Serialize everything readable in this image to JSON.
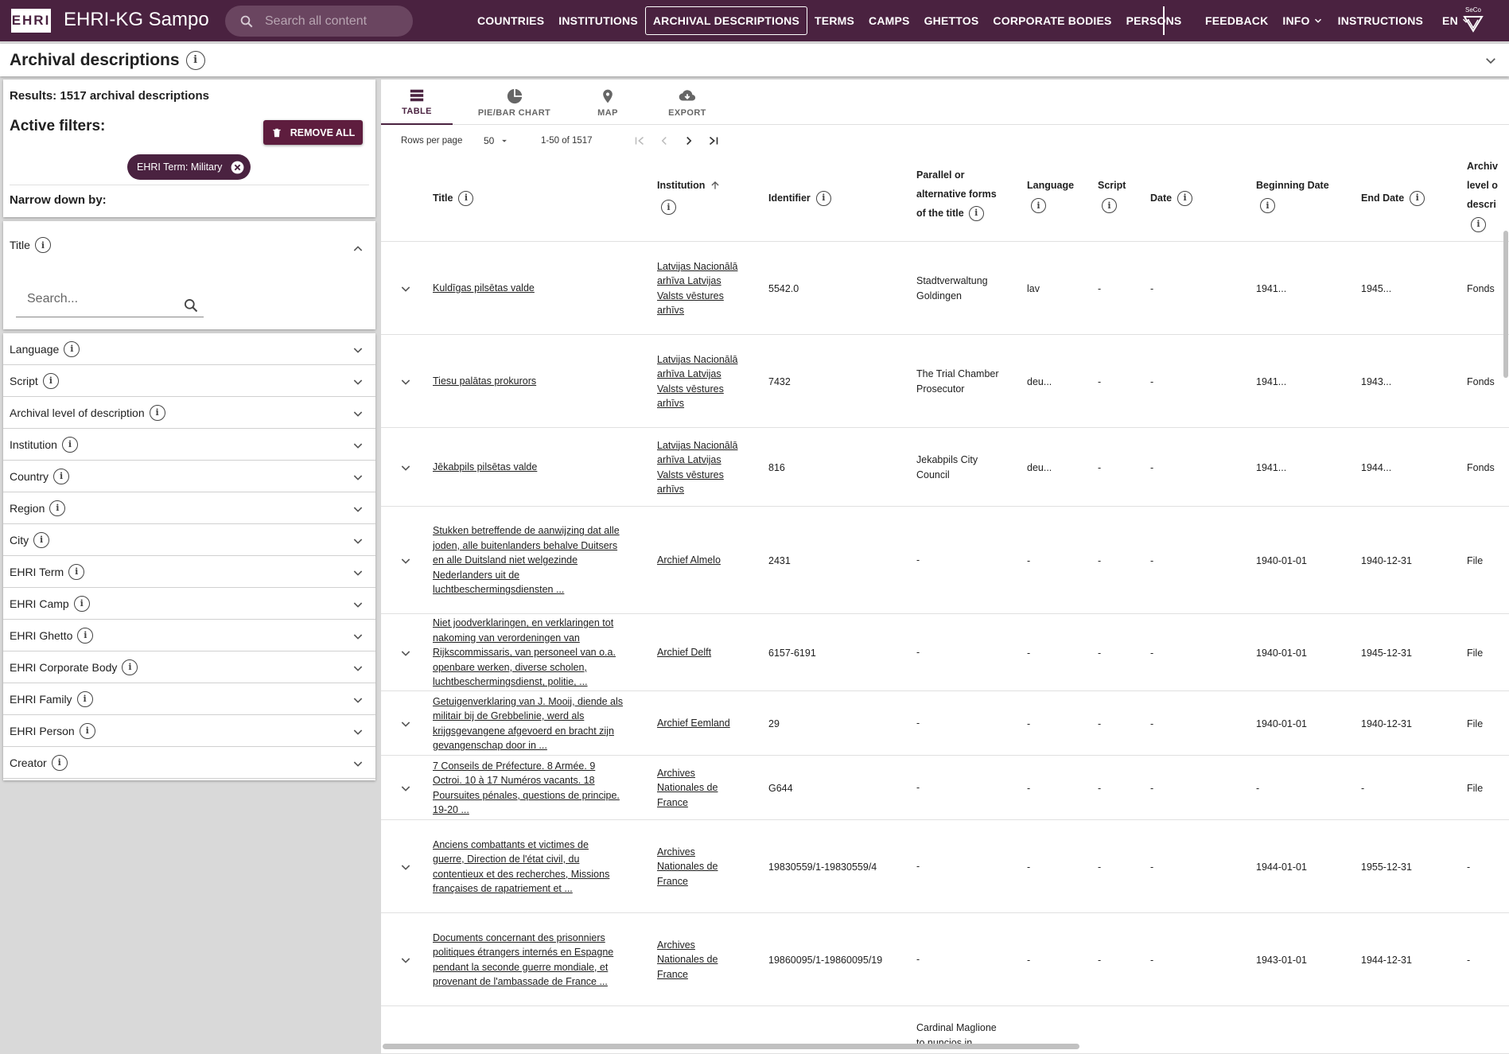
{
  "app": {
    "logo": "EHRI",
    "title": "EHRI-KG Sampo",
    "search_placeholder": "Search all content",
    "seco": "SeCo"
  },
  "nav": [
    "COUNTRIES",
    "INSTITUTIONS",
    "ARCHIVAL DESCRIPTIONS",
    "TERMS",
    "CAMPS",
    "GHETTOS",
    "CORPORATE BODIES",
    "PERSONS"
  ],
  "nav_right": [
    "FEEDBACK",
    "INFO",
    "INSTRUCTIONS",
    "EN"
  ],
  "page": {
    "title": "Archival descriptions"
  },
  "filters": {
    "results": "Results: 1517 archival descriptions",
    "active_label": "Active filters:",
    "remove_all": "REMOVE ALL",
    "chip": "EHRI Term: Military",
    "narrow": "Narrow down by:",
    "title_facet": "Title",
    "search_placeholder": "Search..."
  },
  "facets": [
    "Language",
    "Script",
    "Archival level of description",
    "Institution",
    "Country",
    "Region",
    "City",
    "EHRI Term",
    "EHRI Camp",
    "EHRI Ghetto",
    "EHRI Corporate Body",
    "EHRI Family",
    "EHRI Person",
    "Creator"
  ],
  "tabs": [
    "TABLE",
    "PIE/BAR CHART",
    "MAP",
    "EXPORT"
  ],
  "pagination": {
    "rows_per_page": "Rows per page",
    "rows": "50",
    "range": "1-50 of 1517"
  },
  "columns": {
    "title": "Title",
    "institution": "Institution",
    "identifier": "Identifier",
    "parallel": [
      "Parallel or",
      "alternative forms",
      "of the title"
    ],
    "language": "Language",
    "script": "Script",
    "date": "Date",
    "begin": "Beginning Date",
    "end": "End Date",
    "level": [
      "Archiv",
      "level o",
      "descri"
    ]
  },
  "rows": [
    {
      "title": [
        "Kuldīgas pilsētas valde"
      ],
      "inst": [
        "Latvijas Nacionālā",
        "arhīva Latvijas",
        "Valsts vēstures",
        "arhīvs"
      ],
      "id": "5542.0",
      "par": [
        "Stadtverwaltung",
        "Goldingen"
      ],
      "lang": "lav",
      "script": "-",
      "date": "-",
      "begin": "1941...",
      "end": "1945...",
      "level": "Fonds"
    },
    {
      "title": [
        "Tiesu palātas prokurors"
      ],
      "inst": [
        "Latvijas Nacionālā",
        "arhīva Latvijas",
        "Valsts vēstures",
        "arhīvs"
      ],
      "id": "7432",
      "par": [
        "The Trial Chamber",
        "Prosecutor"
      ],
      "lang": "deu...",
      "script": "-",
      "date": "-",
      "begin": "1941...",
      "end": "1943...",
      "level": "Fonds"
    },
    {
      "title": [
        "Jēkabpils pilsētas valde"
      ],
      "inst": [
        "Latvijas Nacionālā",
        "arhīva Latvijas",
        "Valsts vēstures",
        "arhīvs"
      ],
      "id": "816",
      "par": [
        "Jekabpils City",
        "Council"
      ],
      "lang": "deu...",
      "script": "-",
      "date": "-",
      "begin": "1941...",
      "end": "1944...",
      "level": "Fonds"
    },
    {
      "title": [
        "Stukken betreffende de aanwijzing dat alle",
        "joden, alle buitenlanders behalve Duitsers",
        "en alle Duitsland niet welgezinde",
        "Nederlanders uit de",
        "luchtbeschermingsdiensten ..."
      ],
      "inst": [
        "Archief Almelo"
      ],
      "id": "2431",
      "par": [
        "-"
      ],
      "lang": "-",
      "script": "-",
      "date": "-",
      "begin": "1940-01-01",
      "end": "1940-12-31",
      "level": "File"
    },
    {
      "title": [
        "Niet joodverklaringen, en verklaringen tot",
        "nakoming van verordeningen van",
        "Rijkscommissaris, van personeel van o.a.",
        "openbare werken, diverse scholen,",
        "luchtbeschermingsdienst, politie, ..."
      ],
      "inst": [
        "Archief Delft"
      ],
      "id": "6157-6191",
      "par": [
        "-"
      ],
      "lang": "-",
      "script": "-",
      "date": "-",
      "begin": "1940-01-01",
      "end": "1945-12-31",
      "level": "File"
    },
    {
      "title": [
        "Getuigenverklaring van J. Mooij, diende als",
        "militair bij de Grebbelinie, werd als",
        "krijgsgevangene afgevoerd en bracht zijn",
        "gevangenschap door in ..."
      ],
      "inst": [
        "Archief Eemland"
      ],
      "id": "29",
      "par": [
        "-"
      ],
      "lang": "-",
      "script": "-",
      "date": "-",
      "begin": "1940-01-01",
      "end": "1940-12-31",
      "level": "File"
    },
    {
      "title": [
        "7 Conseils de Préfecture. 8 Armée. 9",
        "Octroi. 10 à 17 Numéros vacants. 18",
        "Poursuites pénales, questions de principe.",
        "19-20 ..."
      ],
      "inst": [
        "Archives",
        "Nationales de",
        "France"
      ],
      "id": "G644",
      "par": [
        "-"
      ],
      "lang": "-",
      "script": "-",
      "date": "-",
      "begin": "-",
      "end": "-",
      "level": "File"
    },
    {
      "title": [
        "Anciens combattants et victimes de",
        "guerre, Direction de l'état civil, du",
        "contentieux et des recherches, Missions",
        "françaises de rapatriement et ..."
      ],
      "inst": [
        "Archives",
        "Nationales de",
        "France"
      ],
      "id": "19830559/1-19830559/4",
      "par": [
        "-"
      ],
      "lang": "-",
      "script": "-",
      "date": "-",
      "begin": "1944-01-01",
      "end": "1955-12-31",
      "level": "-"
    },
    {
      "title": [
        "Documents concernant des prisonniers",
        "politiques étrangers internés en Espagne",
        "pendant la seconde guerre mondiale, et",
        "provenant de l'ambassade de France ..."
      ],
      "inst": [
        "Archives",
        "Nationales de",
        "France"
      ],
      "id": "19860095/1-19860095/19",
      "par": [
        "-"
      ],
      "lang": "-",
      "script": "-",
      "date": "-",
      "begin": "1943-01-01",
      "end": "1944-12-31",
      "level": "-"
    },
    {
      "title": [],
      "inst": [],
      "id": "",
      "par": [
        "Cardinal Maglione",
        "to nuncios in"
      ],
      "lang": "",
      "script": "",
      "date": "",
      "begin": "",
      "end": "",
      "level": ""
    }
  ]
}
